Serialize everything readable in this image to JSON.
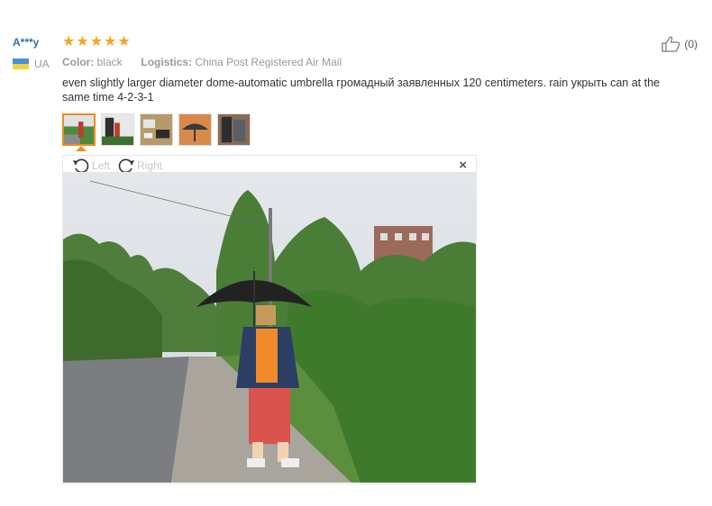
{
  "reviewer": {
    "name": "A***y",
    "country": "UA"
  },
  "rating": {
    "stars": 5
  },
  "attributes": {
    "color_label": "Color:",
    "color_value": "black",
    "logistics_label": "Logistics:",
    "logistics_value": "China Post Registered Air Mail"
  },
  "helpful": {
    "count": "(0)"
  },
  "review": {
    "text": "even slightly larger diameter dome-automatic umbrella громадный заявленных 120 centimeters. rain укрыть can at the same time 4-2-3-1"
  },
  "thumbnails": {
    "count": 5,
    "selected_index": 0
  },
  "viewer": {
    "rotate_left_label": "Left",
    "rotate_right_label": "Right",
    "close_symbol": "×"
  },
  "colors": {
    "accent": "#f08a24",
    "star": "#f5a623",
    "name": "#2e6fb4"
  }
}
